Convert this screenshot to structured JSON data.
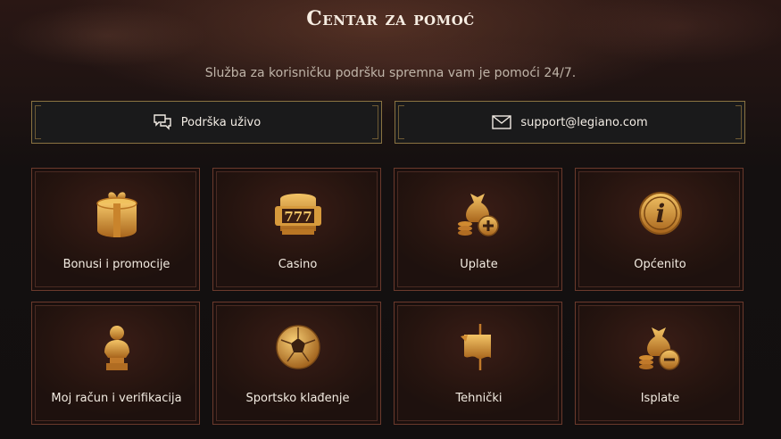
{
  "header": {
    "title": "Centar za pomoć",
    "subtitle": "Služba za korisničku podršku spremna vam je pomoći 24/7."
  },
  "contacts": {
    "live_chat": {
      "label": "Podrška uživo",
      "icon": "chat-bubbles-icon"
    },
    "email": {
      "label": "support@legiano.com",
      "icon": "envelope-icon"
    }
  },
  "categories": [
    {
      "label": "Bonusi i promocije",
      "icon": "gift-box-icon"
    },
    {
      "label": "Casino",
      "icon": "slot-machine-icon"
    },
    {
      "label": "Uplate",
      "icon": "money-bag-plus-icon"
    },
    {
      "label": "Općenito",
      "icon": "info-icon"
    },
    {
      "label": "Moj račun i verifikacija",
      "icon": "bust-statue-icon"
    },
    {
      "label": "Sportsko klađenje",
      "icon": "soccer-ball-icon"
    },
    {
      "label": "Tehnički",
      "icon": "banner-standard-icon"
    },
    {
      "label": "Isplate",
      "icon": "money-bag-minus-icon"
    }
  ],
  "colors": {
    "gold": "#d99a3a",
    "card_border": "#6b3a2c",
    "button_border": "#8a7342"
  }
}
